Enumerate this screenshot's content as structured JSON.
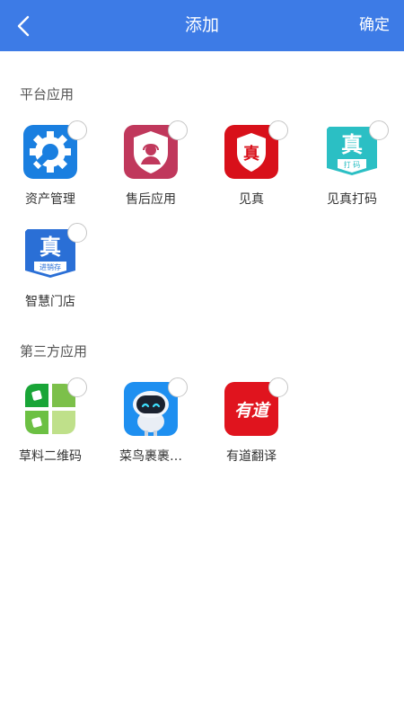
{
  "header": {
    "title": "添加",
    "confirm_label": "确定",
    "accent": "#3d7be6"
  },
  "sections": [
    {
      "title": "平台应用",
      "apps": [
        {
          "label": "资产管理",
          "icon": "asset-management-icon"
        },
        {
          "label": "售后应用",
          "icon": "after-sales-icon"
        },
        {
          "label": "见真",
          "icon": "jianzhen-icon",
          "icon_text": "真"
        },
        {
          "label": "见真打码",
          "icon": "jianzhen-code-icon",
          "icon_text": "真",
          "icon_subtext": "打 码"
        },
        {
          "label": "智慧门店",
          "icon": "smart-store-icon",
          "icon_text": "真",
          "icon_subtext": "进销存"
        }
      ]
    },
    {
      "title": "第三方应用",
      "apps": [
        {
          "label": "草料二维码",
          "icon": "caoliao-qrcode-icon"
        },
        {
          "label": "菜鸟裹裹…",
          "icon": "cainiao-robot-icon"
        },
        {
          "label": "有道翻译",
          "icon": "youdao-translate-icon",
          "icon_text": "有道"
        }
      ]
    }
  ]
}
